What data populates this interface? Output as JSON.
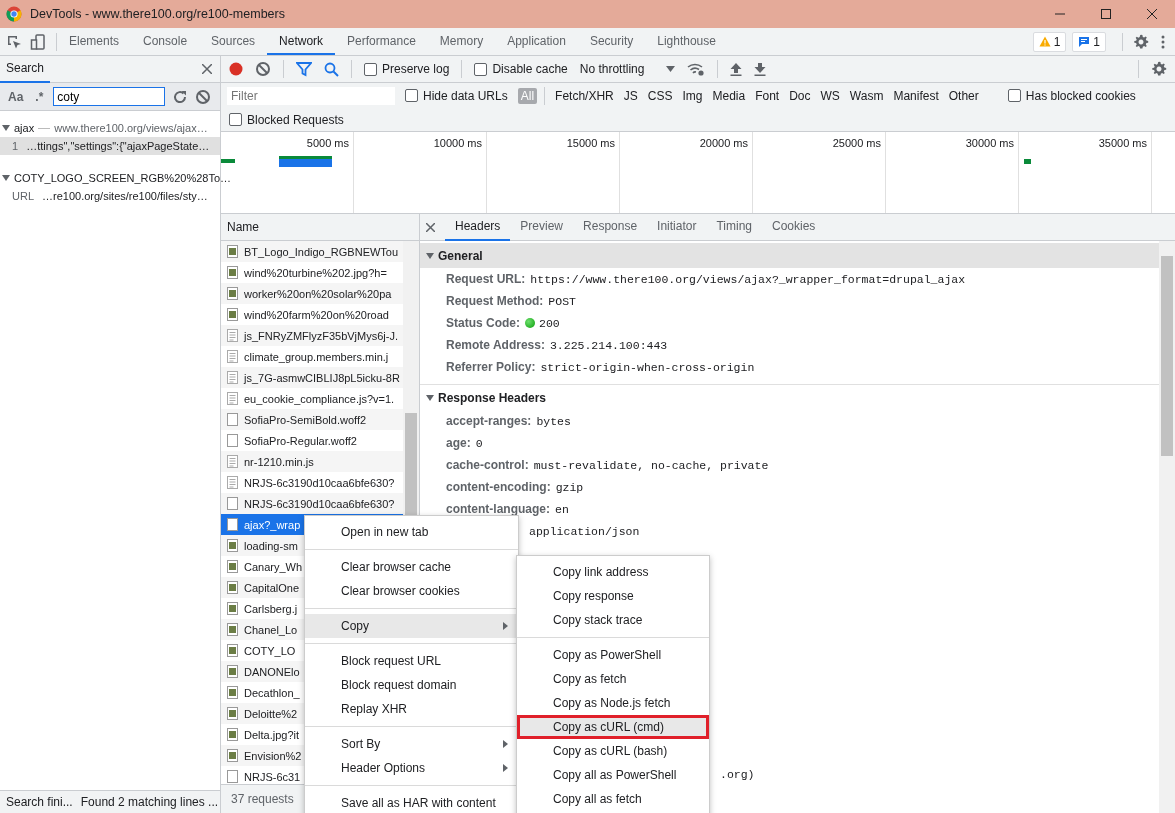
{
  "window": {
    "title": "DevTools - www.there100.org/re100-members"
  },
  "devtools_tabs": [
    {
      "label": "Elements",
      "selected": false
    },
    {
      "label": "Console",
      "selected": false
    },
    {
      "label": "Sources",
      "selected": false
    },
    {
      "label": "Network",
      "selected": true
    },
    {
      "label": "Performance",
      "selected": false
    },
    {
      "label": "Memory",
      "selected": false
    },
    {
      "label": "Application",
      "selected": false
    },
    {
      "label": "Security",
      "selected": false
    },
    {
      "label": "Lighthouse",
      "selected": false
    }
  ],
  "issues": {
    "warnings": "1",
    "messages": "1"
  },
  "search_panel": {
    "tab": "Search",
    "case_label": "Aa",
    "regex_label": ".*",
    "query": "coty",
    "results": [
      {
        "file": "ajax",
        "url": "www.there100.org/views/ajax…",
        "expanded": true,
        "matches": [
          {
            "line": "1",
            "text": "…ttings\",\"settings\":{\"ajaxPageState…",
            "selected": true
          }
        ]
      },
      {
        "file": "COTY_LOGO_SCREEN_RGB%20%28To…",
        "expanded": true,
        "matches": [
          {
            "line": "URL",
            "text": "…re100.org/sites/re100/files/sty…",
            "selected": false
          }
        ]
      }
    ],
    "status": "Search fini...",
    "summary": "Found 2 matching lines ..."
  },
  "network": {
    "recording": true,
    "preserve_log": {
      "label": "Preserve log",
      "checked": false
    },
    "disable_cache": {
      "label": "Disable cache",
      "checked": false
    },
    "throttling": "No throttling",
    "filter_placeholder": "Filter",
    "hide_data_urls": {
      "label": "Hide data URLs",
      "checked": false
    },
    "types": [
      {
        "label": "All",
        "selected": true
      },
      {
        "label": "Fetch/XHR",
        "selected": false
      },
      {
        "label": "JS",
        "selected": false
      },
      {
        "label": "CSS",
        "selected": false
      },
      {
        "label": "Img",
        "selected": false
      },
      {
        "label": "Media",
        "selected": false
      },
      {
        "label": "Font",
        "selected": false
      },
      {
        "label": "Doc",
        "selected": false
      },
      {
        "label": "WS",
        "selected": false
      },
      {
        "label": "Wasm",
        "selected": false
      },
      {
        "label": "Manifest",
        "selected": false
      },
      {
        "label": "Other",
        "selected": false
      }
    ],
    "has_blocked_cookies": {
      "label": "Has blocked cookies",
      "checked": false
    },
    "blocked_requests": {
      "label": "Blocked Requests",
      "checked": false
    },
    "overview_ticks": [
      "5000 ms",
      "10000 ms",
      "15000 ms",
      "20000 ms",
      "25000 ms",
      "30000 ms",
      "35000 ms"
    ],
    "name_header": "Name",
    "requests": [
      {
        "name": "BT_Logo_Indigo_RGBNEWTou",
        "kind": "image",
        "selected": false
      },
      {
        "name": "wind%20turbine%202.jpg?h=",
        "kind": "image",
        "selected": false
      },
      {
        "name": "worker%20on%20solar%20pa",
        "kind": "image",
        "selected": false
      },
      {
        "name": "wind%20farm%20on%20road",
        "kind": "image",
        "selected": false
      },
      {
        "name": "js_FNRyZMFlyzF35bVjMys6j-J.",
        "kind": "script",
        "selected": false
      },
      {
        "name": "climate_group.members.min.j",
        "kind": "script",
        "selected": false
      },
      {
        "name": "js_7G-asmwCIBLIJ8pL5icku-8R",
        "kind": "script",
        "selected": false
      },
      {
        "name": "eu_cookie_compliance.js?v=1.",
        "kind": "script",
        "selected": false
      },
      {
        "name": "SofiaPro-SemiBold.woff2",
        "kind": "blank",
        "selected": false
      },
      {
        "name": "SofiaPro-Regular.woff2",
        "kind": "blank",
        "selected": false
      },
      {
        "name": "nr-1210.min.js",
        "kind": "script",
        "selected": false
      },
      {
        "name": "NRJS-6c3190d10caa6bfe630?",
        "kind": "script",
        "selected": false
      },
      {
        "name": "NRJS-6c3190d10caa6bfe630?",
        "kind": "blank",
        "selected": false
      },
      {
        "name": "ajax?_wrap",
        "kind": "blank",
        "selected": true
      },
      {
        "name": "loading-sm",
        "kind": "image",
        "selected": false
      },
      {
        "name": "Canary_Wh",
        "kind": "image",
        "selected": false
      },
      {
        "name": "CapitalOne",
        "kind": "image",
        "selected": false
      },
      {
        "name": "Carlsberg.j",
        "kind": "image",
        "selected": false
      },
      {
        "name": "Chanel_Lo",
        "kind": "image",
        "selected": false
      },
      {
        "name": "COTY_LO",
        "kind": "image",
        "selected": false
      },
      {
        "name": "DANONElo",
        "kind": "image",
        "selected": false
      },
      {
        "name": "Decathlon_",
        "kind": "image",
        "selected": false
      },
      {
        "name": "Deloitte%2",
        "kind": "image",
        "selected": false
      },
      {
        "name": "Delta.jpg?it",
        "kind": "image",
        "selected": false
      },
      {
        "name": "Envision%2",
        "kind": "image",
        "selected": false
      },
      {
        "name": "NRJS-6c31",
        "kind": "blank",
        "selected": false
      }
    ],
    "footer": "37 requests"
  },
  "details": {
    "tabs": [
      {
        "label": "Headers",
        "selected": true
      },
      {
        "label": "Preview",
        "selected": false
      },
      {
        "label": "Response",
        "selected": false
      },
      {
        "label": "Initiator",
        "selected": false
      },
      {
        "label": "Timing",
        "selected": false
      },
      {
        "label": "Cookies",
        "selected": false
      }
    ],
    "sections": [
      {
        "title": "General",
        "expanded": true,
        "rows": [
          {
            "kind": "plain",
            "key": "Request URL:",
            "value": "https://www.there100.org/views/ajax?_wrapper_format=drupal_ajax"
          },
          {
            "kind": "plain",
            "key": "Request Method:",
            "value": "POST"
          },
          {
            "kind": "status",
            "key": "Status Code:",
            "value": "200"
          },
          {
            "kind": "plain",
            "key": "Remote Address:",
            "value": "3.225.214.100:443"
          },
          {
            "kind": "plain",
            "key": "Referrer Policy:",
            "value": "strict-origin-when-cross-origin"
          }
        ]
      },
      {
        "title": "Response Headers",
        "expanded": true,
        "rows": [
          {
            "kind": "plain",
            "key": "accept-ranges:",
            "value": "bytes"
          },
          {
            "kind": "plain",
            "key": "age:",
            "value": "0"
          },
          {
            "kind": "plain",
            "key": "cache-control:",
            "value": "must-revalidate, no-cache, private"
          },
          {
            "kind": "plain",
            "key": "content-encoding:",
            "value": "gzip"
          },
          {
            "kind": "plain",
            "key": "content-language:",
            "value": "en"
          },
          {
            "kind": "after-menu",
            "value": "application/json"
          },
          {
            "kind": "after-submenu",
            "value": ".org)"
          }
        ]
      }
    ]
  },
  "context_menu": {
    "groups": [
      [
        {
          "label": "Open in new tab",
          "submenu": false,
          "hovered": false
        }
      ],
      [
        {
          "label": "Clear browser cache",
          "submenu": false,
          "hovered": false
        },
        {
          "label": "Clear browser cookies",
          "submenu": false,
          "hovered": false
        }
      ],
      [
        {
          "label": "Copy",
          "submenu": true,
          "hovered": true
        }
      ],
      [
        {
          "label": "Block request URL",
          "submenu": false,
          "hovered": false
        },
        {
          "label": "Block request domain",
          "submenu": false,
          "hovered": false
        },
        {
          "label": "Replay XHR",
          "submenu": false,
          "hovered": false
        }
      ],
      [
        {
          "label": "Sort By",
          "submenu": true,
          "hovered": false
        },
        {
          "label": "Header Options",
          "submenu": true,
          "hovered": false
        }
      ],
      [
        {
          "label": "Save all as HAR with content",
          "submenu": false,
          "hovered": false
        }
      ]
    ]
  },
  "copy_submenu": {
    "groups": [
      [
        {
          "label": "Copy link address",
          "hovered": false,
          "outlined": false
        },
        {
          "label": "Copy response",
          "hovered": false,
          "outlined": false
        },
        {
          "label": "Copy stack trace",
          "hovered": false,
          "outlined": false
        }
      ],
      [
        {
          "label": "Copy as PowerShell",
          "hovered": false,
          "outlined": false
        },
        {
          "label": "Copy as fetch",
          "hovered": false,
          "outlined": false
        },
        {
          "label": "Copy as Node.js fetch",
          "hovered": false,
          "outlined": false
        },
        {
          "label": "Copy as cURL (cmd)",
          "hovered": true,
          "outlined": true
        },
        {
          "label": "Copy as cURL (bash)",
          "hovered": false,
          "outlined": false
        },
        {
          "label": "Copy all as PowerShell",
          "hovered": false,
          "outlined": false
        },
        {
          "label": "Copy all as fetch",
          "hovered": false,
          "outlined": false
        }
      ]
    ]
  }
}
